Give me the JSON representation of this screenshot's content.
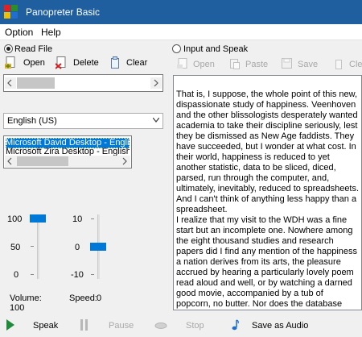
{
  "window": {
    "title": "Panopreter Basic"
  },
  "menu": {
    "option": "Option",
    "help": "Help"
  },
  "read_file": {
    "radio_label": "Read File",
    "open_label": "Open",
    "delete_label": "Delete",
    "clear_label": "Clear"
  },
  "input_speak": {
    "radio_label": "Input and Speak",
    "open_label": "Open",
    "paste_label": "Paste",
    "save_label": "Save",
    "clear_label": "Clea"
  },
  "language": {
    "selected": "English (US)"
  },
  "voices": {
    "items": [
      "Microsoft David Desktop - English",
      "Microsoft Zira Desktop - English"
    ]
  },
  "text": {
    "paragraph1": "That is, I suppose, the whole point of this new, dispassionate study of happiness. Veenhoven and the other blissologists desperately wanted academia to take their discipline seriously, lest they be dismissed as New Age faddists. They have succeeded, but I wonder at what cost. In their world, happiness is reduced to yet another statistic, data to be sliced, diced, parsed, run through the computer, and, ultimately, inevitably, reduced to spreadsheets. And I can't think of anything less happy than a spreadsheet.",
    "paragraph2": "I realize that my visit to the WDH was a fine start but an incomplete one. Nowhere among the eight thousand studies and research papers did I find any mention of the happiness a nation derives from its arts, the pleasure accrued by hearing a particularly lovely poem read aloud and well, or by watching a darned good movie, accompanied by a tub of popcorn, no butter. Nor does the database reveal anything about the invisible threads that bind a"
  },
  "volume": {
    "scale": [
      "100",
      "50",
      "0"
    ],
    "label": "Volume:",
    "value": "100",
    "level": 1.0
  },
  "speed": {
    "scale": [
      "10",
      "0",
      "-10"
    ],
    "label": "Speed:",
    "value": "0",
    "level": 0.5
  },
  "controls": {
    "speak": "Speak",
    "pause": "Pause",
    "stop": "Stop",
    "save_audio": "Save as Audio"
  },
  "colors": {
    "accent": "#0078d7",
    "titlebar": "#1f5fa0"
  }
}
